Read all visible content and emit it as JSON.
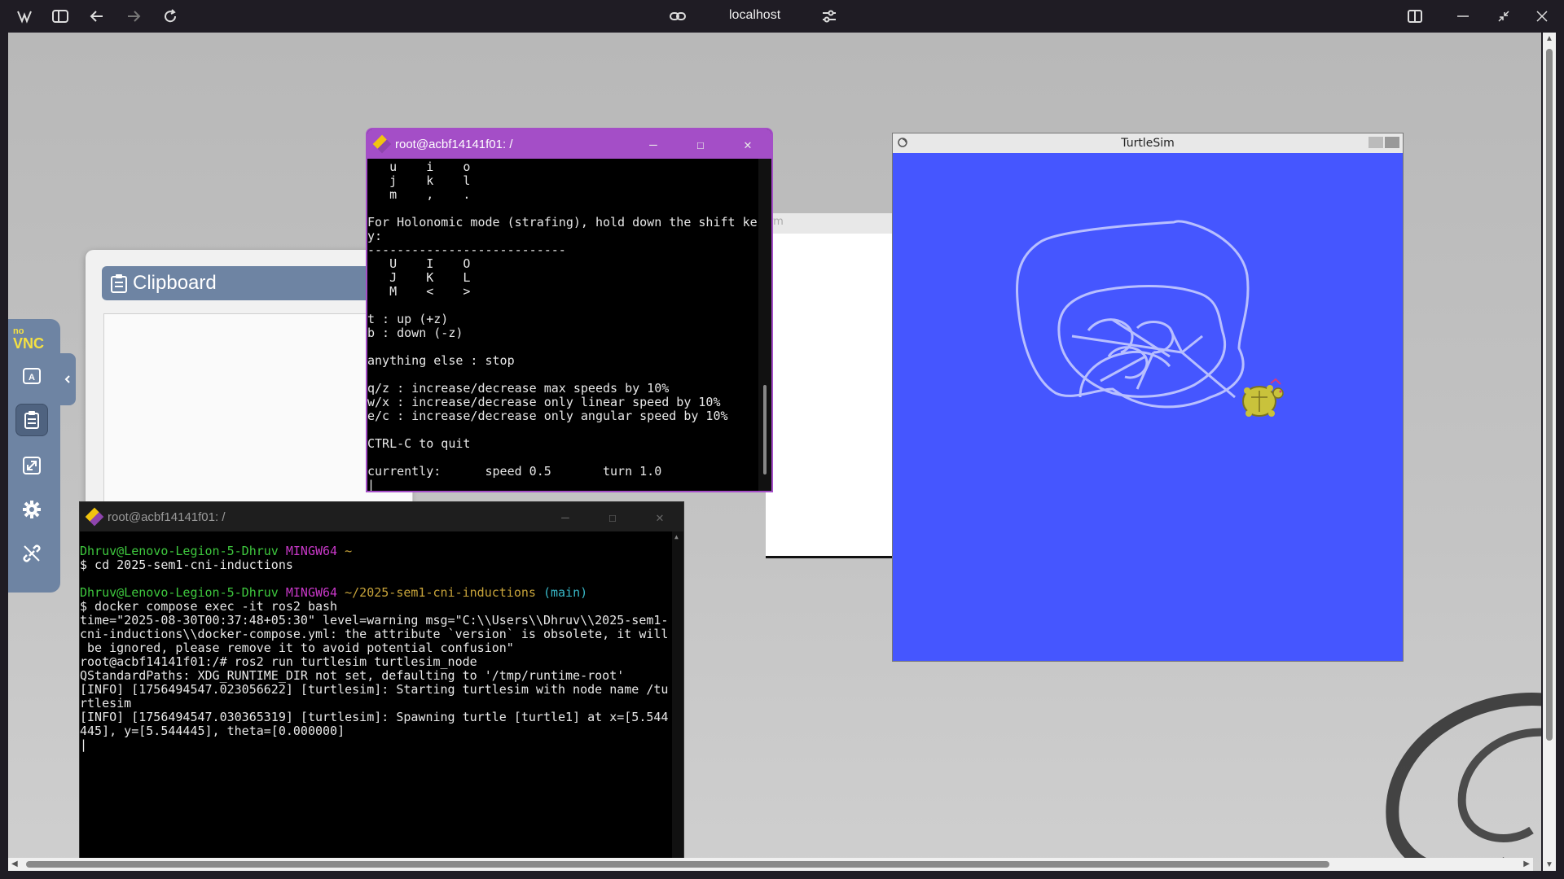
{
  "browser": {
    "url": "localhost"
  },
  "clipboard": {
    "title": "Clipboard"
  },
  "novnc": {
    "logo_top": "no",
    "logo_bottom": "VNC"
  },
  "xterm_back": {
    "title": "rm"
  },
  "teleop_terminal": {
    "title": "root@acbf14141f01: /",
    "lines": [
      "   u    i    o",
      "   j    k    l",
      "   m    ,    .",
      "",
      "For Holonomic mode (strafing), hold down the shift ke",
      "y:",
      "---------------------------",
      "   U    I    O",
      "   J    K    L",
      "   M    <    >",
      "",
      "t : up (+z)",
      "b : down (-z)",
      "",
      "anything else : stop",
      "",
      "q/z : increase/decrease max speeds by 10%",
      "w/x : increase/decrease only linear speed by 10%",
      "e/c : increase/decrease only angular speed by 10%",
      "",
      "CTRL-C to quit",
      "",
      "currently:      speed 0.5       turn 1.0",
      "|"
    ]
  },
  "main_terminal": {
    "title": "root@acbf14141f01: /",
    "prompt1_user": "Dhruv@Lenovo-Legion-5-Dhruv",
    "prompt1_env": "MINGW64",
    "prompt1_path": "~",
    "cmd1": "$ cd 2025-sem1-cni-inductions",
    "prompt2_user": "Dhruv@Lenovo-Legion-5-Dhruv",
    "prompt2_env": "MINGW64",
    "prompt2_path": "~/2025-sem1-cni-inductions",
    "prompt2_branch": "(main)",
    "cmd2": "$ docker compose exec -it ros2 bash",
    "output": [
      "time=\"2025-08-30T00:37:48+05:30\" level=warning msg=\"C:\\\\Users\\\\Dhruv\\\\2025-sem1-",
      "cni-inductions\\\\docker-compose.yml: the attribute `version` is obsolete, it will",
      " be ignored, please remove it to avoid potential confusion\"",
      "root@acbf14141f01:/# ros2 run turtlesim turtlesim_node",
      "QStandardPaths: XDG_RUNTIME_DIR not set, defaulting to '/tmp/runtime-root'",
      "[INFO] [1756494547.023056622] [turtlesim]: Starting turtlesim with node name /tu",
      "rtlesim",
      "[INFO] [1756494547.030365319] [turtlesim]: Spawning turtle [turtle1] at x=[5.544",
      "445], y=[5.544445], theta=[0.000000]",
      "|"
    ]
  },
  "turtlesim": {
    "title": "TurtleSim",
    "background": "#4556ff",
    "trail_color": "#b8bfff"
  }
}
